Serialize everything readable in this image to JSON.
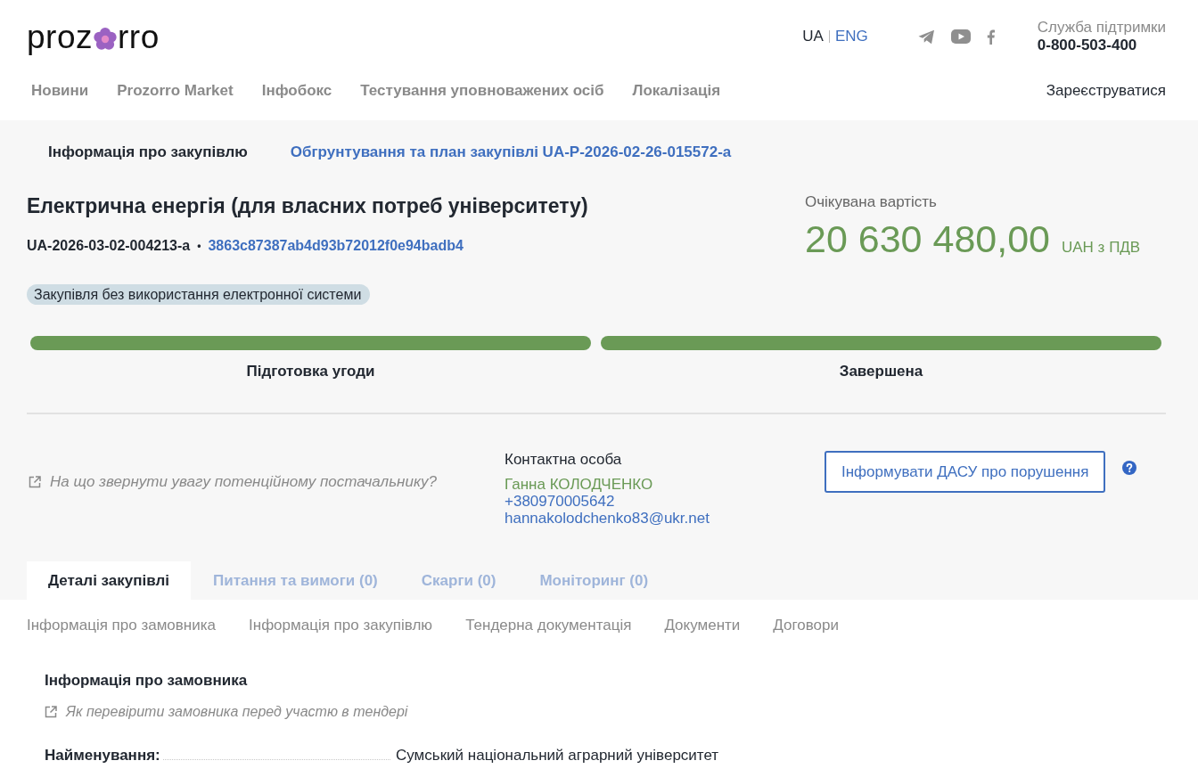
{
  "header": {
    "logo": {
      "before": "proz",
      "after": "rro"
    },
    "languages": [
      {
        "label": "UA",
        "selected": true
      },
      {
        "label": "ENG",
        "selected": false
      }
    ],
    "support": {
      "label": "Служба підтримки",
      "phone": "0-800-503-400"
    },
    "nav": [
      "Новини",
      "Prozorro Market",
      "Інфобокс",
      "Тестування уповноважених осіб",
      "Локалізація"
    ],
    "register": "Зареєструватися"
  },
  "procurement_tabs": [
    {
      "label": "Інформація про закупівлю",
      "selected": true
    },
    {
      "label": "Обгрунтування та план закупівлі UA-P-2026-02-26-015572-a",
      "selected": false
    }
  ],
  "title": "Електрична енергія (для власних потреб університету)",
  "tender_id": "UA-2026-03-02-004213-a",
  "separator": "•",
  "hash": "3863c87387ab4d93b72012f0e94badb4",
  "tag": "Закупівля без використання електронної системи",
  "expected_value": {
    "label": "Очікувана вартість",
    "amount": "20 630 480,00",
    "currency": "UAH з ПДВ"
  },
  "stages": [
    {
      "label": "Підготовка угоди",
      "done": true
    },
    {
      "label": "Завершена",
      "done": true
    }
  ],
  "tip_link": "На що звернути увагу потенційному постачальнику?",
  "contact": {
    "heading": "Контактна особа",
    "name": "Ганна КОЛОДЧЕНКО",
    "phone": "+380970005642",
    "email": "hannakolodchenko83@ukr.net"
  },
  "report_button": "Інформувати ДАСУ про порушення",
  "tabs": [
    {
      "label": "Деталі закупівлі",
      "selected": true
    },
    {
      "label": "Питання та вимоги (0)",
      "selected": false
    },
    {
      "label": "Скарги (0)",
      "selected": false
    },
    {
      "label": "Моніторинг (0)",
      "selected": false
    }
  ],
  "subnav": [
    "Інформація про замовника",
    "Інформація про закупівлю",
    "Тендерна документація",
    "Документи",
    "Договори"
  ],
  "section": {
    "heading": "Інформація про замовника",
    "link": "Як перевірити замовника перед участю в тендері",
    "fields": [
      {
        "label": "Найменування:",
        "value": "Сумський національний аграрний університет"
      }
    ]
  }
}
